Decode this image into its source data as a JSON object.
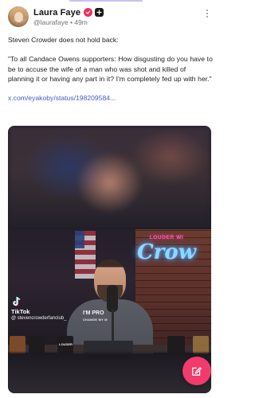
{
  "post": {
    "author": {
      "display_name": "Laura Faye",
      "handle": "@laurafaye",
      "separator": "•",
      "time_ago": "49m",
      "verified_color": "#ef2f62"
    },
    "text_intro": "Steven Crowder does not hold back:",
    "text_quote": "\"To all Candace Owens supporters: How disgusting do you have to be to accuse the wife of a man who was shot and killed of planning it or having any part in it? I'm completely fed up with her.\"",
    "link_text": "x.com/eyakoby/status/198209584..."
  },
  "media": {
    "neon_top": "LOUDER WI",
    "neon_script": "Crow",
    "shirt_line1": "I'M PRO",
    "shirt_line2": "CHANGE MY M",
    "mug_labels": [
      "",
      "",
      "LOUDER",
      "",
      ""
    ],
    "watermark": {
      "brand": "TikTok",
      "handle": "@ stevencrowderfanclub_"
    }
  },
  "actions": {
    "compose_icon": "compose-icon",
    "compose_color": "#f13b6c"
  }
}
